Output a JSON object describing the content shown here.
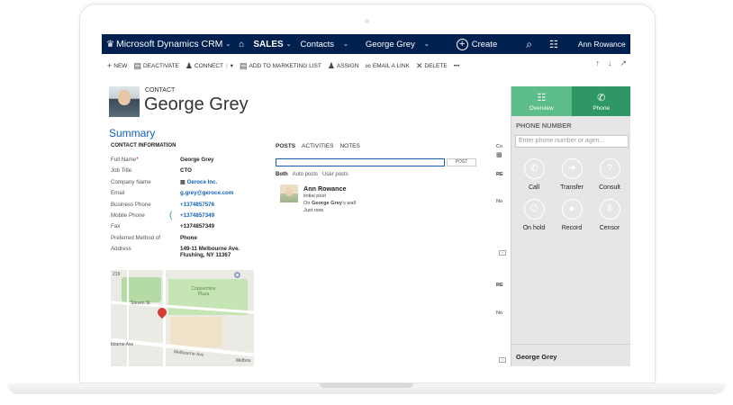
{
  "nav": {
    "logo_mark": "♛",
    "app_title": "Microsoft Dynamics CRM",
    "caret": "⌄",
    "home_icon": "⌂",
    "area": "SALES",
    "entity": "Contacts",
    "record": "George Grey",
    "create_label": "Create",
    "search_icon": "⌕",
    "assistant_icon": "☷",
    "user": "Ann Rowance",
    "settings_icon": "⚙",
    "help_icon": "?"
  },
  "commands": {
    "new": "NEW",
    "deactivate": "DEACTIVATE",
    "connect": "CONNECT",
    "add_marketing": "ADD TO MARKETING LIST",
    "assign": "ASSIGN",
    "email_link": "EMAIL A LINK",
    "delete": "DELETE",
    "more": "•••"
  },
  "header": {
    "entity_type": "CONTACT",
    "name": "George Grey"
  },
  "summary_label": "Summary",
  "contact_info": {
    "title": "CONTACT INFORMATION",
    "fields": [
      {
        "label": "Full Name",
        "value": "George Grey"
      },
      {
        "label": "Job Title",
        "value": "CTO"
      },
      {
        "label": "Company Name",
        "value": "Geroce Inc."
      },
      {
        "label": "Email",
        "value": "g.grey@geroce.com"
      },
      {
        "label": "Business Phone",
        "value": "+1374857576"
      },
      {
        "label": "Mobile Phone",
        "value": "+1374857349"
      },
      {
        "label": "Fax",
        "value": "+1374857349"
      },
      {
        "label": "Preferred Method of",
        "value": "Phone"
      },
      {
        "label": "Address",
        "value": "149-11 Melbourne Ave.",
        "value2": "Flushing, NY 11367"
      }
    ]
  },
  "map": {
    "labels": [
      "219",
      "Coppermine Plaza",
      "Steven St",
      "bourne Ave",
      "Melbourne Ave",
      "Melbou"
    ]
  },
  "posts": {
    "tabs": [
      "POSTS",
      "ACTIVITIES",
      "NOTES"
    ],
    "post_button": "POST",
    "filters": [
      "Both",
      "Auto posts",
      "User posts"
    ],
    "entry": {
      "author": "Ann Rowance",
      "text": "initial post",
      "context_prefix": "On ",
      "context_target": "George Grey",
      "context_suffix": "'s wall",
      "time": "Just now"
    }
  },
  "partial_column": [
    "Co",
    "RE",
    "No",
    "RE",
    "No"
  ],
  "dialer": {
    "tabs": [
      {
        "label": "Overview",
        "icon": "☷"
      },
      {
        "label": "Phone",
        "icon": "✆"
      }
    ],
    "phone_number_label": "PHONE NUMBER",
    "input_placeholder": "Enter phone number or agen...",
    "controls": [
      {
        "label": "Call",
        "icon": "✆"
      },
      {
        "label": "Transfer",
        "icon": "➔"
      },
      {
        "label": "Consult",
        "icon": "?"
      },
      {
        "label": "On hold",
        "icon": "∅"
      },
      {
        "label": "Record",
        "icon": "●"
      },
      {
        "label": "Censor",
        "icon": "Ⅱ"
      }
    ],
    "active_contact": "George Grey"
  }
}
